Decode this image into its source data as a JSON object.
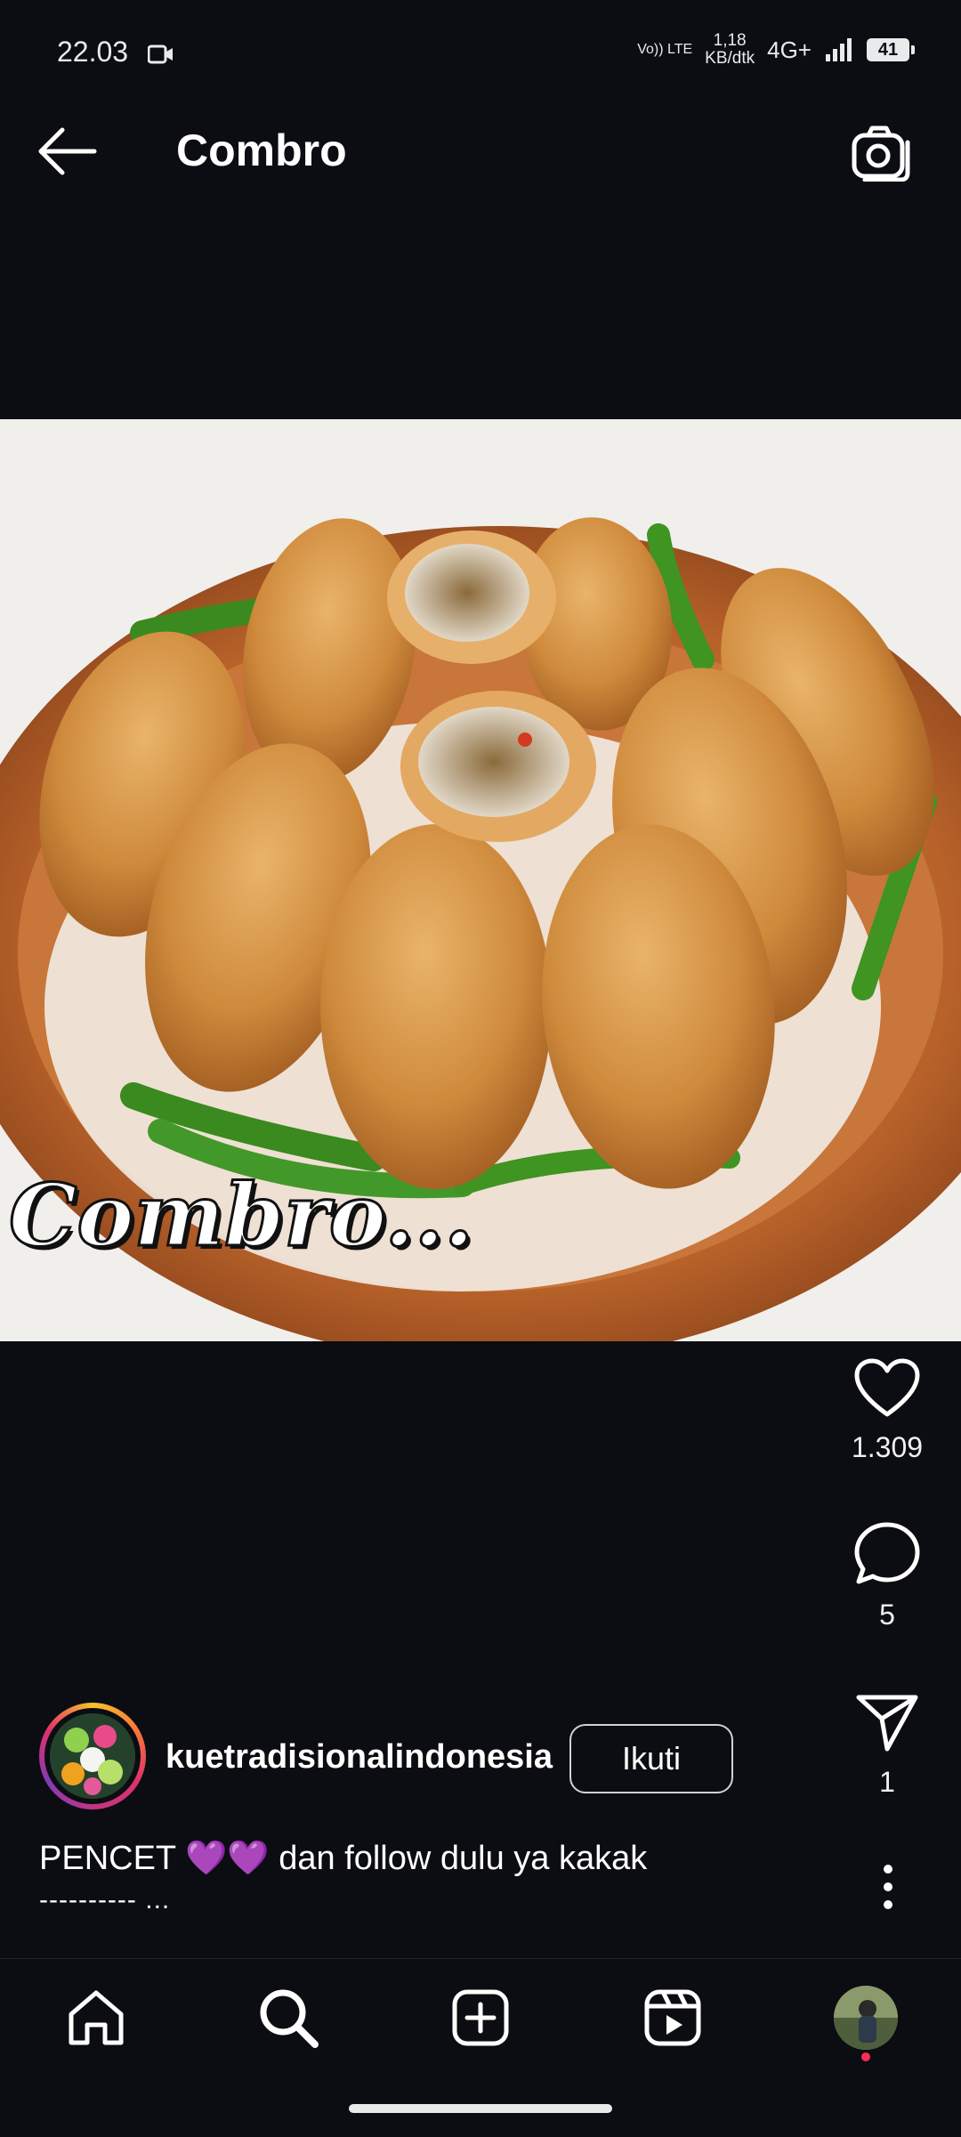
{
  "status_bar": {
    "time": "22.03",
    "volte": "Vo)) LTE",
    "speed_value": "1,18",
    "speed_unit": "KB/dtk",
    "network": "4G+",
    "battery": "41"
  },
  "header": {
    "title": "Combro"
  },
  "post": {
    "image_overlay_text": "Combro...",
    "likes": "1.309",
    "comments": "5",
    "shares": "1",
    "username": "kuetradisionalindonesia",
    "follow_label": "Ikuti",
    "caption": "PENCET 💜💜 dan follow dulu ya kakak",
    "caption_more": "---------- ..."
  },
  "nav": {
    "items": [
      "home",
      "search",
      "create",
      "reels",
      "profile"
    ]
  },
  "colors": {
    "background": "#0b0d12",
    "text": "#ffffff",
    "notification_dot": "#ff2d55"
  }
}
